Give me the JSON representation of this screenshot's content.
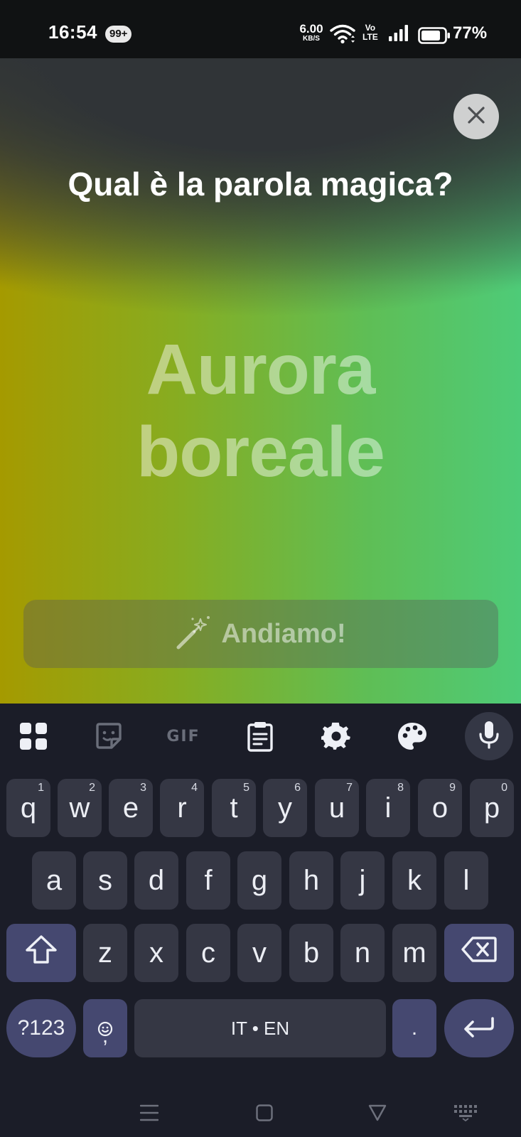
{
  "status_bar": {
    "time": "16:54",
    "notification_badge": "99+",
    "net_speed_value": "6.00",
    "net_speed_unit": "KB/S",
    "volte_top": "Vo",
    "volte_bottom": "LTE",
    "battery_percent": "77%"
  },
  "prompt": {
    "title": "Qual è la parola magica?",
    "word_line1": "Aurora",
    "word_line2": "boreale",
    "submit_label": "Andiamo!"
  },
  "keyboard": {
    "toolbar": [
      "apps-grid-icon",
      "sticker-icon",
      "GIF",
      "clipboard-icon",
      "settings-gear-icon",
      "palette-icon",
      "microphone-icon"
    ],
    "gif_label": "GIF",
    "row1": [
      {
        "k": "q",
        "n": "1"
      },
      {
        "k": "w",
        "n": "2"
      },
      {
        "k": "e",
        "n": "3"
      },
      {
        "k": "r",
        "n": "4"
      },
      {
        "k": "t",
        "n": "5"
      },
      {
        "k": "y",
        "n": "6"
      },
      {
        "k": "u",
        "n": "7"
      },
      {
        "k": "i",
        "n": "8"
      },
      {
        "k": "o",
        "n": "9"
      },
      {
        "k": "p",
        "n": "0"
      }
    ],
    "row2": [
      "a",
      "s",
      "d",
      "f",
      "g",
      "h",
      "j",
      "k",
      "l"
    ],
    "row3": [
      "z",
      "x",
      "c",
      "v",
      "b",
      "n",
      "m"
    ],
    "symbols_label": "?123",
    "comma_label": ",",
    "space_label": "IT • EN",
    "period_label": "."
  },
  "colors": {
    "gradient_left": "#a59a00",
    "gradient_right": "#4ecb78",
    "keyboard_bg": "#1b1d28",
    "key_bg": "#353744",
    "modifier_key_bg": "#454870"
  }
}
